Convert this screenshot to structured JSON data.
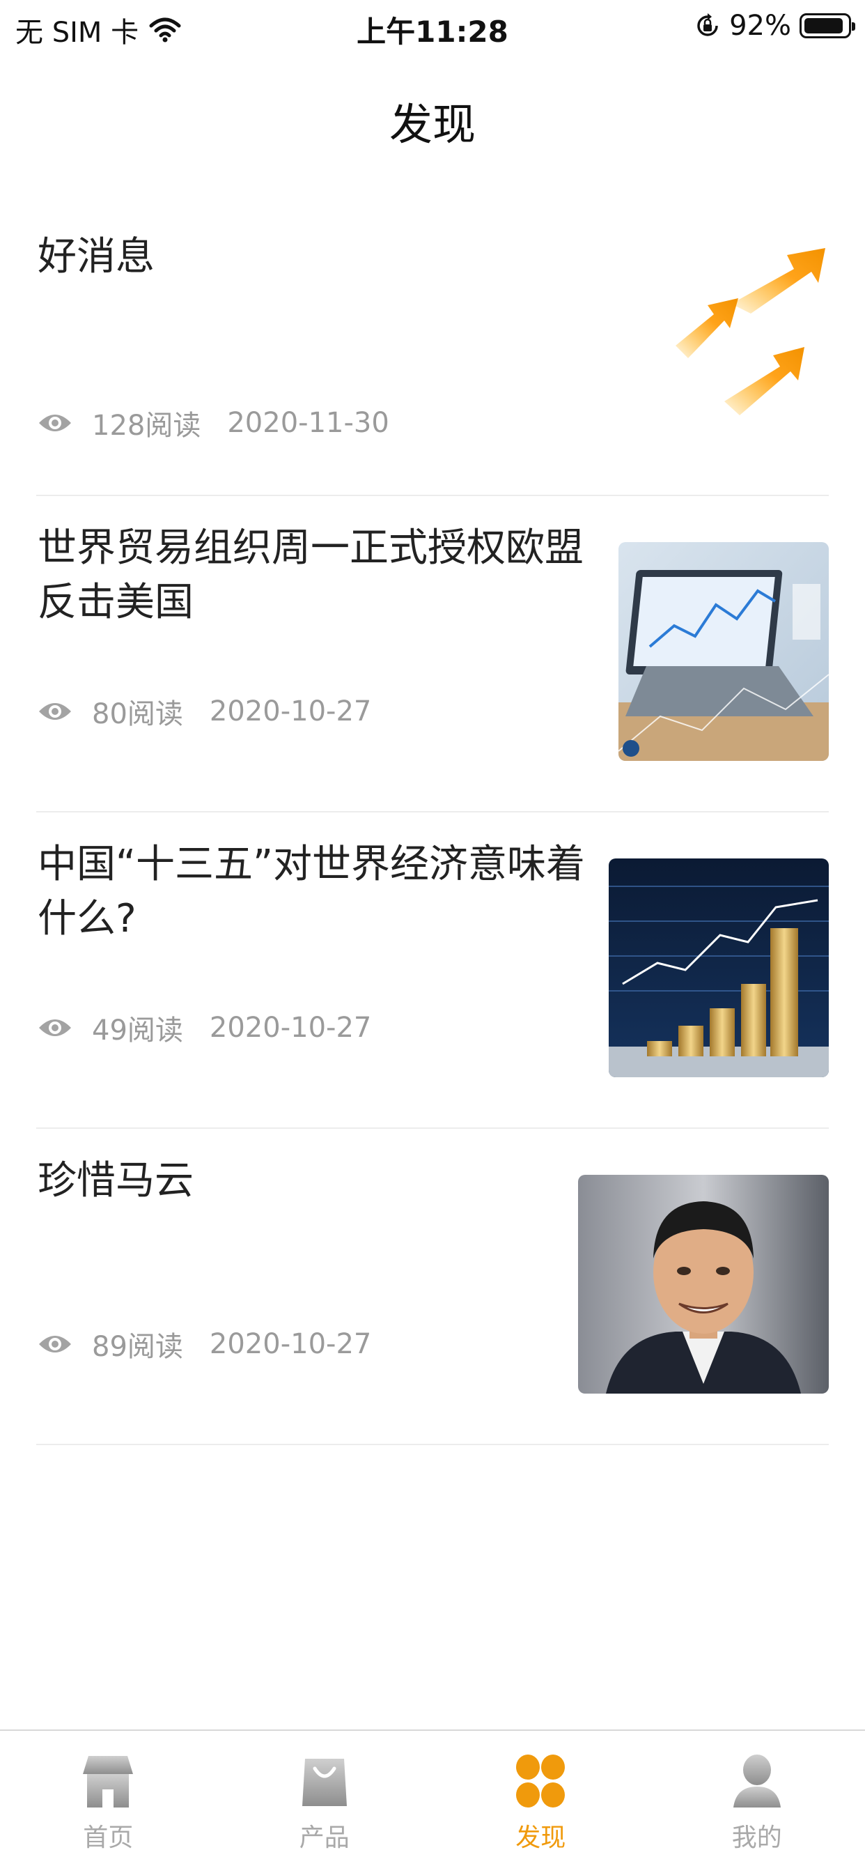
{
  "status_bar": {
    "carrier": "无 SIM 卡",
    "time": "上午11:28",
    "battery": "92%",
    "battery_level": 0.92
  },
  "page": {
    "title": "发现"
  },
  "news": [
    {
      "title": "好消息",
      "reads": "128阅读",
      "date": "2020-11-30",
      "image": "orange-arrows-graphic"
    },
    {
      "title": "世界贸易组织周一正式授权欧盟反击美国",
      "reads": "80阅读",
      "date": "2020-10-27",
      "image": "laptop-chart-photo"
    },
    {
      "title": "中国“十三五”对世界经济意味着什么?",
      "reads": "49阅读",
      "date": "2020-10-27",
      "image": "coin-stacks-chart-photo"
    },
    {
      "title": "珍惜马云",
      "reads": "89阅读",
      "date": "2020-10-27",
      "image": "portrait-photo"
    }
  ],
  "tabs": [
    {
      "label": "首页",
      "icon": "store-icon",
      "active": false
    },
    {
      "label": "产品",
      "icon": "shopping-bag-icon",
      "active": false
    },
    {
      "label": "发现",
      "icon": "clover-icon",
      "active": true
    },
    {
      "label": "我的",
      "icon": "person-icon",
      "active": false
    }
  ],
  "colors": {
    "accent": "#f09a0c",
    "inactive": "#a9a9a9",
    "meta": "#9a9a9a"
  }
}
